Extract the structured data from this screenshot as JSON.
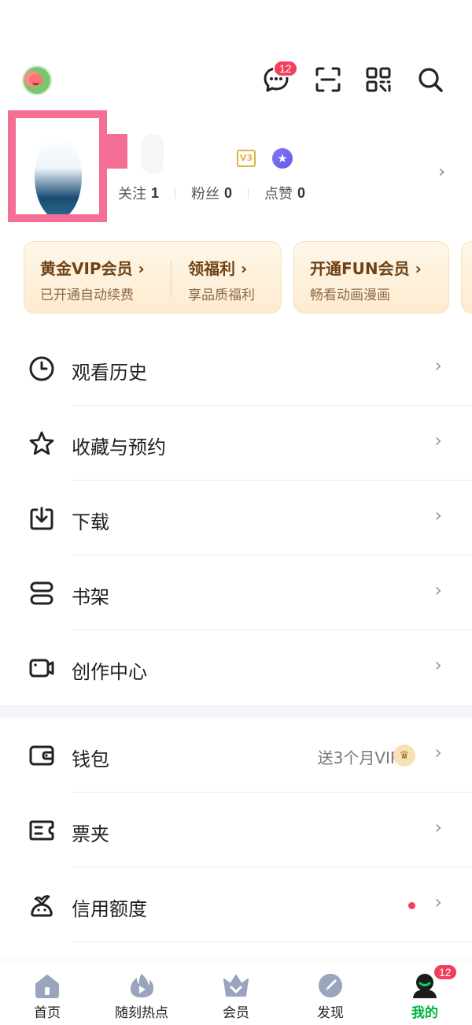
{
  "header": {
    "messages_badge": "12",
    "icons": [
      "message-icon",
      "scan-icon",
      "qr-code-icon",
      "search-icon"
    ]
  },
  "profile": {
    "stats": [
      {
        "label": "关注",
        "value": "1"
      },
      {
        "label": "粉丝",
        "value": "0"
      },
      {
        "label": "点赞",
        "value": "0"
      }
    ]
  },
  "vip": {
    "gold_title": "黄金VIP会员",
    "gold_sub": "已开通自动续费",
    "welfare_title": "领福利",
    "welfare_sub": "享品质福利",
    "fun_title": "开通FUN会员",
    "fun_sub": "畅看动画漫画",
    "chevron": "›"
  },
  "menu_group_1": [
    {
      "label": "观看历史",
      "icon": "history-clock-icon"
    },
    {
      "label": "收藏与预约",
      "icon": "star-icon"
    },
    {
      "label": "下载",
      "icon": "download-icon"
    },
    {
      "label": "书架",
      "icon": "bookshelf-icon"
    },
    {
      "label": "创作中心",
      "icon": "creator-camera-icon"
    }
  ],
  "menu_group_2": [
    {
      "label": "钱包",
      "icon": "wallet-icon",
      "promo": "送3个月VIP"
    },
    {
      "label": "票夹",
      "icon": "ticket-icon"
    },
    {
      "label": "信用额度",
      "icon": "credit-icon"
    }
  ],
  "bottom_nav": [
    {
      "label": "首页",
      "icon": "home-icon"
    },
    {
      "label": "随刻热点",
      "icon": "hot-fire-icon"
    },
    {
      "label": "会员",
      "icon": "crown-icon"
    },
    {
      "label": "发现",
      "icon": "discover-compass-icon"
    },
    {
      "label": "我的",
      "icon": "profile-icon",
      "badge": "12",
      "active": true
    }
  ],
  "colors": {
    "accent_green": "#00b43c",
    "badge_red": "#f33f5e",
    "vip_gold": "#6d4216"
  }
}
